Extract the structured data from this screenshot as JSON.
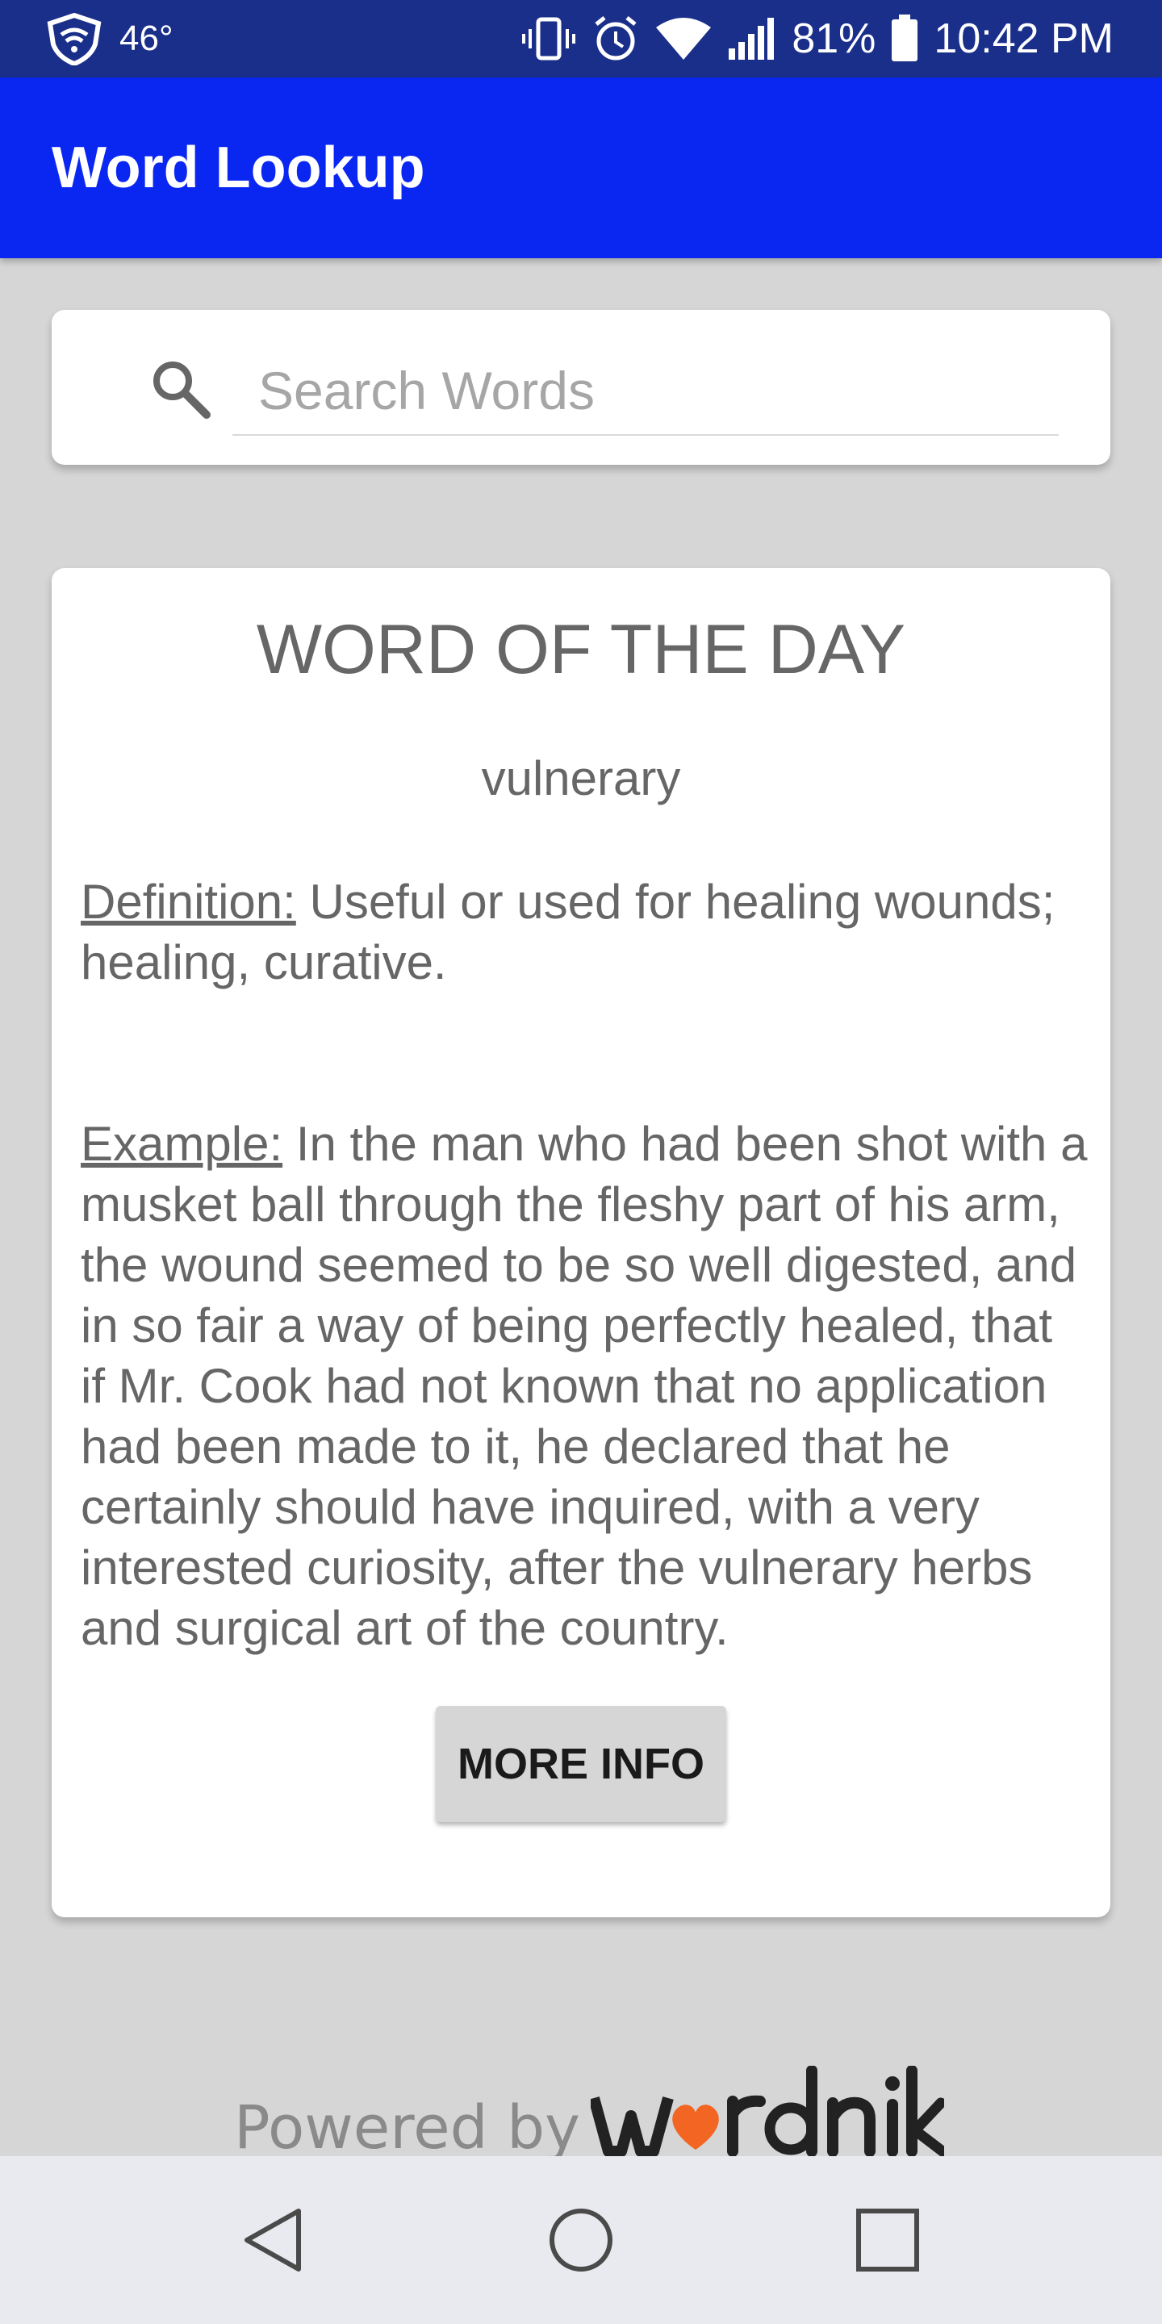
{
  "status_bar": {
    "temperature": "46°",
    "battery": "81%",
    "time": "10:42 PM",
    "icons": [
      "shield-wifi-icon",
      "vibrate-icon",
      "alarm-icon",
      "wifi-icon",
      "signal-icon",
      "battery-icon"
    ]
  },
  "app_bar": {
    "title": "Word Lookup"
  },
  "search": {
    "placeholder": "Search Words",
    "value": ""
  },
  "word_of_the_day": {
    "title": "WORD OF THE DAY",
    "word": "vulnerary",
    "definition_label": "Definition:",
    "definition_text": " Useful or used for healing wounds; healing, curative.",
    "example_label": "Example:",
    "example_text": " In the man who had been shot with a musket ball through the fleshy part of his arm, the wound seemed to be so well digested, and in so fair a way of being perfectly healed, that if Mr. Cook had not known that no application had been made to it, he declared that he certainly should have inquired, with a very interested curiosity, after the vulnerary herbs and surgical art of the country.",
    "more_info_label": "MORE INFO"
  },
  "footer": {
    "powered_by": "Powered by",
    "brand": "wordnik"
  },
  "nav_bar": {
    "buttons": [
      "back-icon",
      "home-icon",
      "recents-icon"
    ]
  },
  "colors": {
    "status_bar": "#1a2f8a",
    "app_bar": "#0a27f2",
    "background": "#d6d6d6",
    "card": "#ffffff",
    "text_gray": "#666666",
    "button_gray": "#d6d6d6",
    "wordnik_heart": "#f26522"
  }
}
